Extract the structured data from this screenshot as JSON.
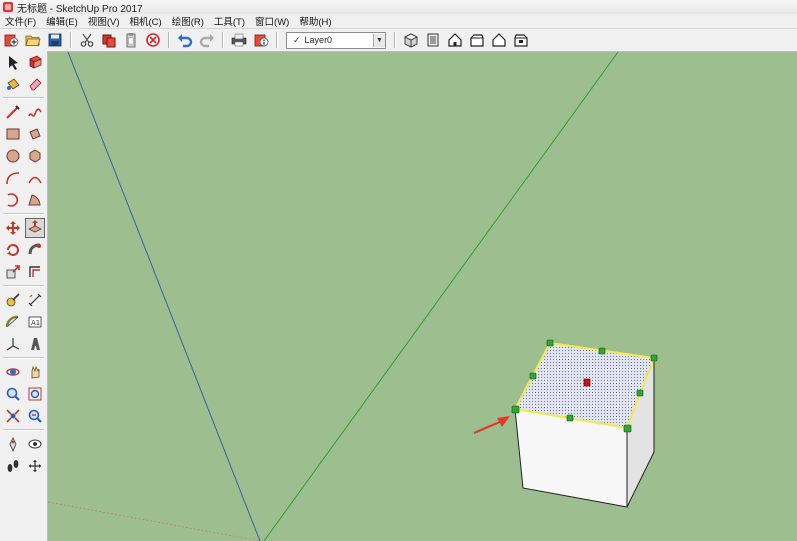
{
  "window": {
    "title": "无标题 - SketchUp Pro 2017"
  },
  "menu": {
    "items": [
      {
        "label": "文件(F)",
        "name": "menu-file"
      },
      {
        "label": "编辑(E)",
        "name": "menu-edit"
      },
      {
        "label": "视图(V)",
        "name": "menu-view"
      },
      {
        "label": "相机(C)",
        "name": "menu-camera"
      },
      {
        "label": "绘图(R)",
        "name": "menu-draw"
      },
      {
        "label": "工具(T)",
        "name": "menu-tools"
      },
      {
        "label": "窗口(W)",
        "name": "menu-window"
      },
      {
        "label": "帮助(H)",
        "name": "menu-help"
      }
    ]
  },
  "toolbar": {
    "layer": {
      "check": "✓",
      "value": "Layer0"
    },
    "icons": [
      "new-file-icon",
      "open-folder-icon",
      "save-icon",
      "cut-icon",
      "copy-icon",
      "paste-icon",
      "erase-icon",
      "undo-icon",
      "redo-icon",
      "print-icon",
      "model-info-icon"
    ],
    "view_icons": [
      "iso-view-icon",
      "top-view-icon",
      "front-view-icon",
      "right-view-icon",
      "back-view-icon",
      "left-view-icon"
    ]
  },
  "left_tools": {
    "active": "push-pull",
    "groups": [
      [
        [
          "select",
          "make-component"
        ],
        [
          "paint-bucket",
          "eraser"
        ]
      ],
      [
        [
          "line",
          "freehand"
        ],
        [
          "rectangle",
          "rotated-rectangle"
        ],
        [
          "circle",
          "polygon"
        ],
        [
          "arc",
          "arc-2point"
        ],
        [
          "arc-3point",
          "pie"
        ]
      ],
      [
        [
          "move",
          "push-pull"
        ],
        [
          "rotate",
          "follow-me"
        ],
        [
          "scale",
          "offset"
        ]
      ],
      [
        [
          "tape-measure",
          "dimension"
        ],
        [
          "protractor",
          "text"
        ],
        [
          "axes",
          "3d-text"
        ]
      ],
      [
        [
          "orbit",
          "pan"
        ],
        [
          "zoom",
          "zoom-window"
        ],
        [
          "zoom-extents",
          "previous-view"
        ]
      ],
      [
        [
          "position-camera",
          "look-around"
        ],
        [
          "walk",
          "section-plane"
        ]
      ]
    ]
  },
  "colors": {
    "background": "#9dbf8f",
    "axis_blue": "#3b5fa8",
    "axis_green": "#2f9e2f",
    "axis_red": "#c47a6a",
    "selection_yellow": "#f2e94e",
    "grip_green": "#2ea82e",
    "center_red": "#cc1111",
    "arrow_red": "#e03a2a"
  }
}
